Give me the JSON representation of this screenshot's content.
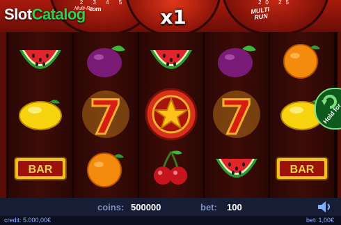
{
  "logo": {
    "slot": "Slot",
    "catalog": "Catalog",
    "com": "com"
  },
  "header": {
    "multiplier": "x1",
    "multi_run_line1": "MULTI",
    "multi_run_line2": "RUN",
    "left_gauge_digits": "2 3 4 5",
    "right_gauge_digits": "20 25",
    "left_gauge_label": "Multi-Re"
  },
  "reels": [
    [
      "watermelon",
      "lemon",
      "bar"
    ],
    [
      "plum",
      "seven",
      "orange"
    ],
    [
      "watermelon",
      "star-wild",
      "cherries"
    ],
    [
      "plum",
      "seven",
      "watermelon"
    ],
    [
      "orange",
      "lemon",
      "bar"
    ]
  ],
  "symbols": {
    "bar_label": "BAR",
    "seven_label": "7"
  },
  "hold": {
    "label": "Hold for"
  },
  "status": {
    "coins_label": "coins:",
    "coins_value": "500000",
    "bet_label": "bet:",
    "bet_value": "100",
    "credit": "credit: 5.000,00€",
    "bet_money": "bet: 1,00€"
  },
  "colors": {
    "accent_green": "#2bd54a",
    "bottom_bar": "#161d34",
    "label_blue": "#7f8fc0"
  }
}
